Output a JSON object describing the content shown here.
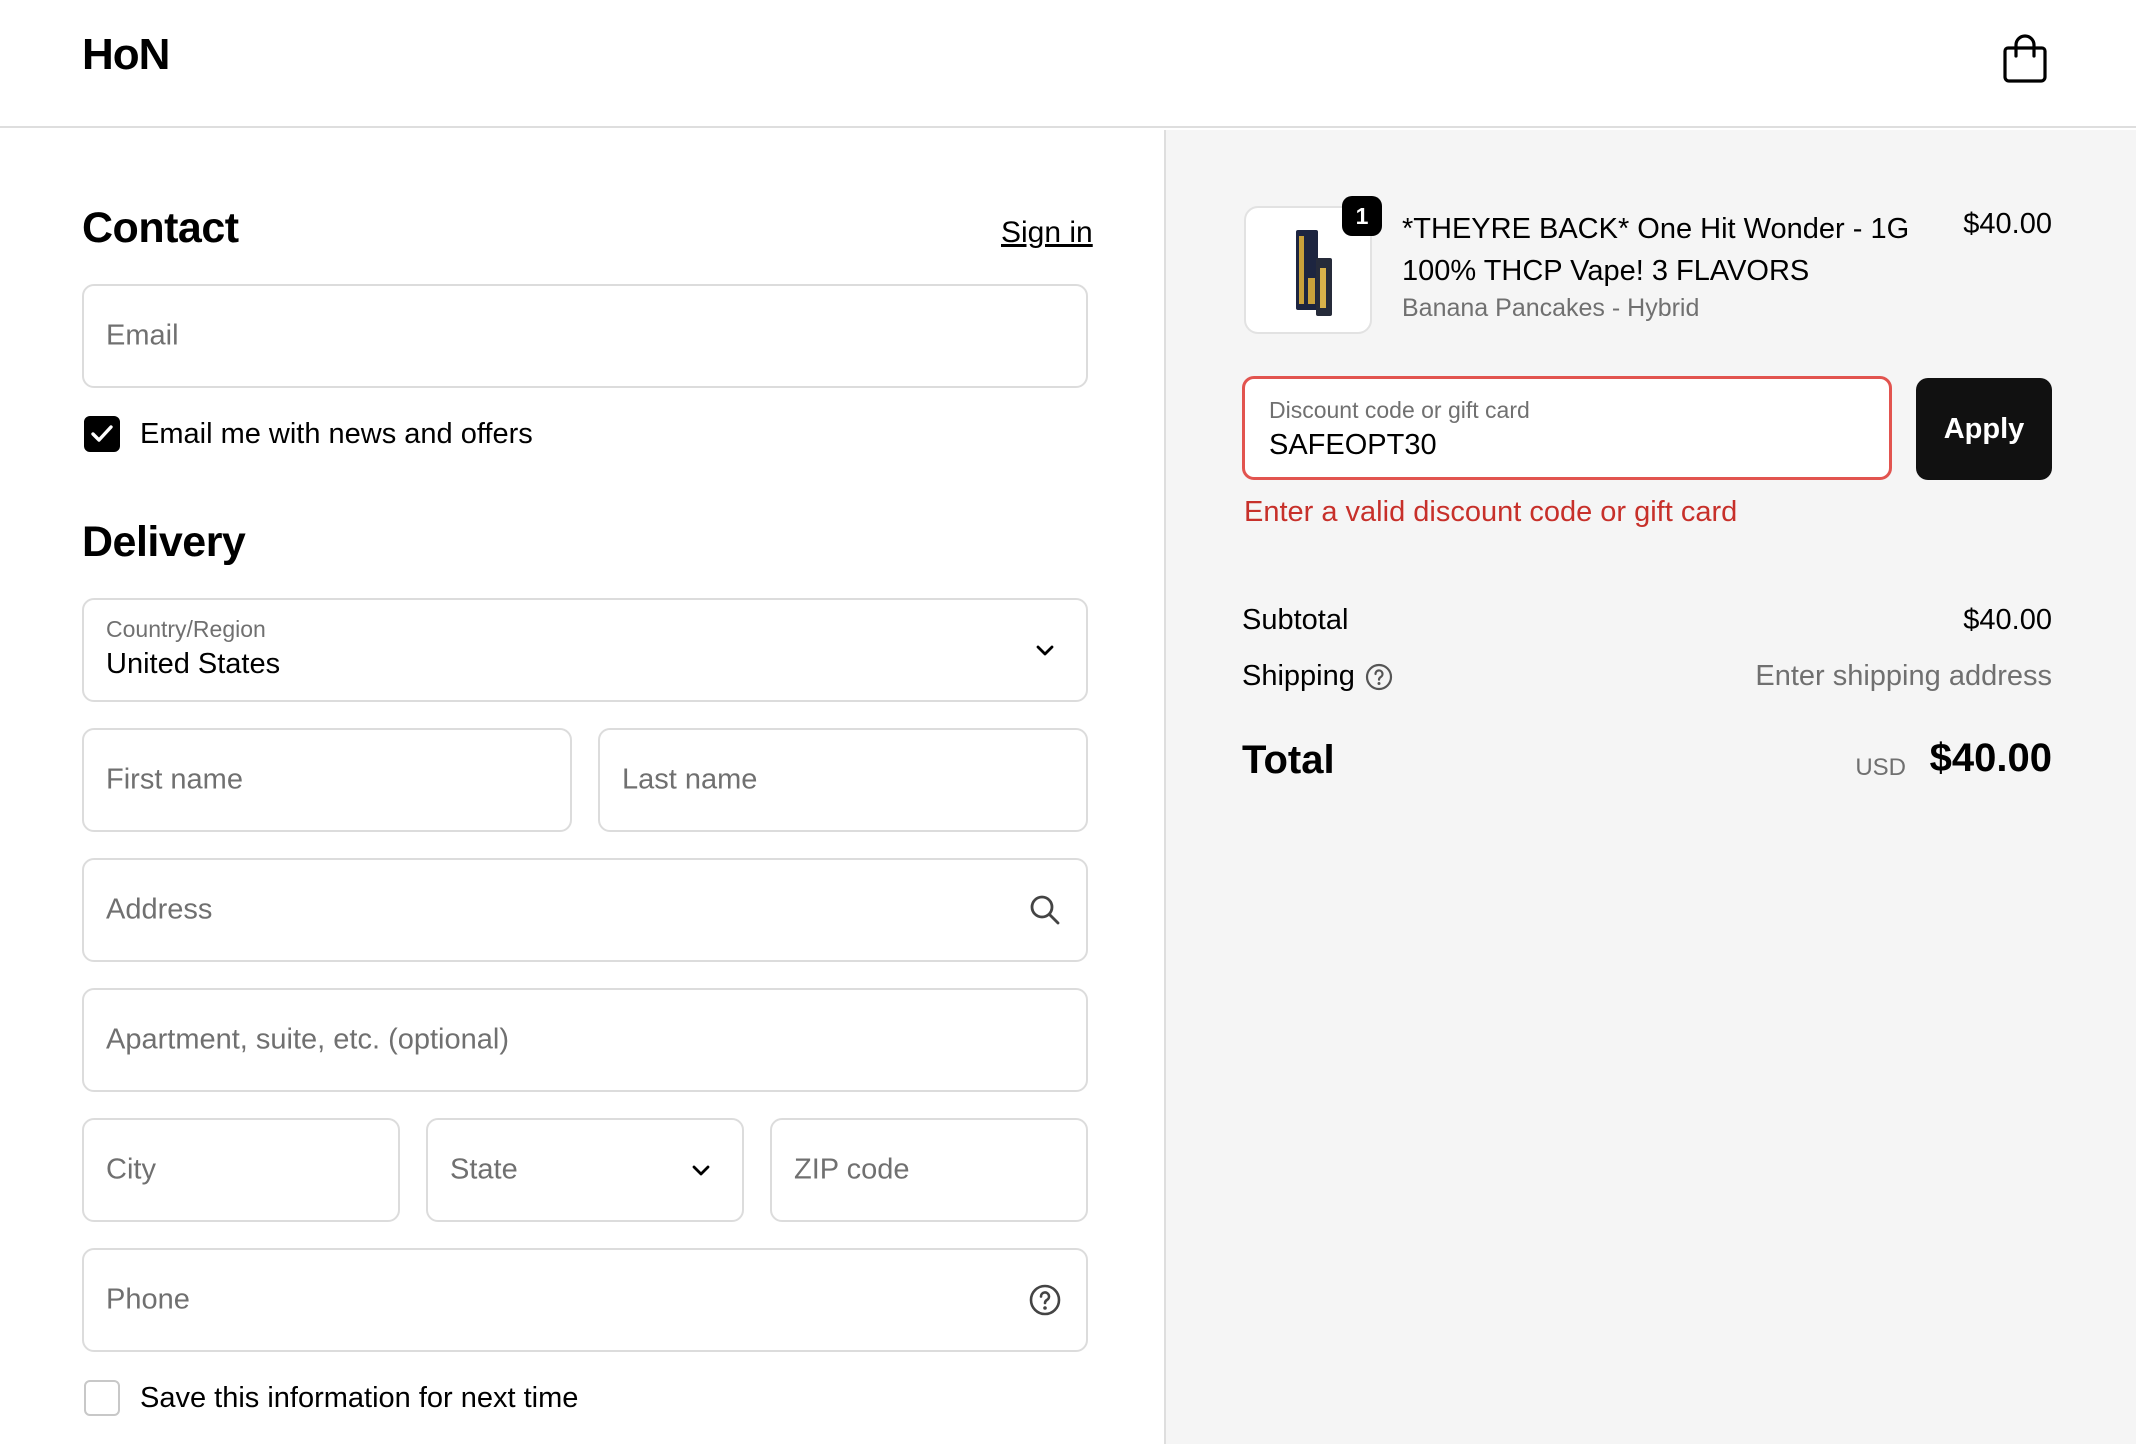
{
  "header": {
    "logo": "HoN",
    "cart_icon": "shopping-bag-icon"
  },
  "contact": {
    "title": "Contact",
    "sign_in": "Sign in",
    "email_placeholder": "Email",
    "newsletter_label": "Email me with news and offers",
    "newsletter_checked": true
  },
  "delivery": {
    "title": "Delivery",
    "country_label": "Country/Region",
    "country_value": "United States",
    "first_name_placeholder": "First name",
    "last_name_placeholder": "Last name",
    "address_placeholder": "Address",
    "apartment_placeholder": "Apartment, suite, etc. (optional)",
    "city_placeholder": "City",
    "state_placeholder": "State",
    "zip_placeholder": "ZIP code",
    "phone_placeholder": "Phone",
    "save_info_label": "Save this information for next time",
    "save_info_checked": false
  },
  "summary": {
    "item": {
      "quantity": "1",
      "name": "*THEYRE BACK* One Hit Wonder - 1G 100% THCP Vape! 3 FLAVORS",
      "variant": "Banana Pancakes - Hybrid",
      "price": "$40.00"
    },
    "discount": {
      "label": "Discount code or gift card",
      "value": "SAFEOPT30",
      "apply_label": "Apply",
      "error": "Enter a valid discount code or gift card"
    },
    "subtotal_label": "Subtotal",
    "subtotal_value": "$40.00",
    "shipping_label": "Shipping",
    "shipping_value": "Enter shipping address",
    "total_label": "Total",
    "total_currency": "USD",
    "total_value": "$40.00"
  },
  "colors": {
    "error": "#c7302a",
    "error_border": "#e2544f",
    "button": "#111111",
    "summary_bg": "#f5f5f5"
  }
}
